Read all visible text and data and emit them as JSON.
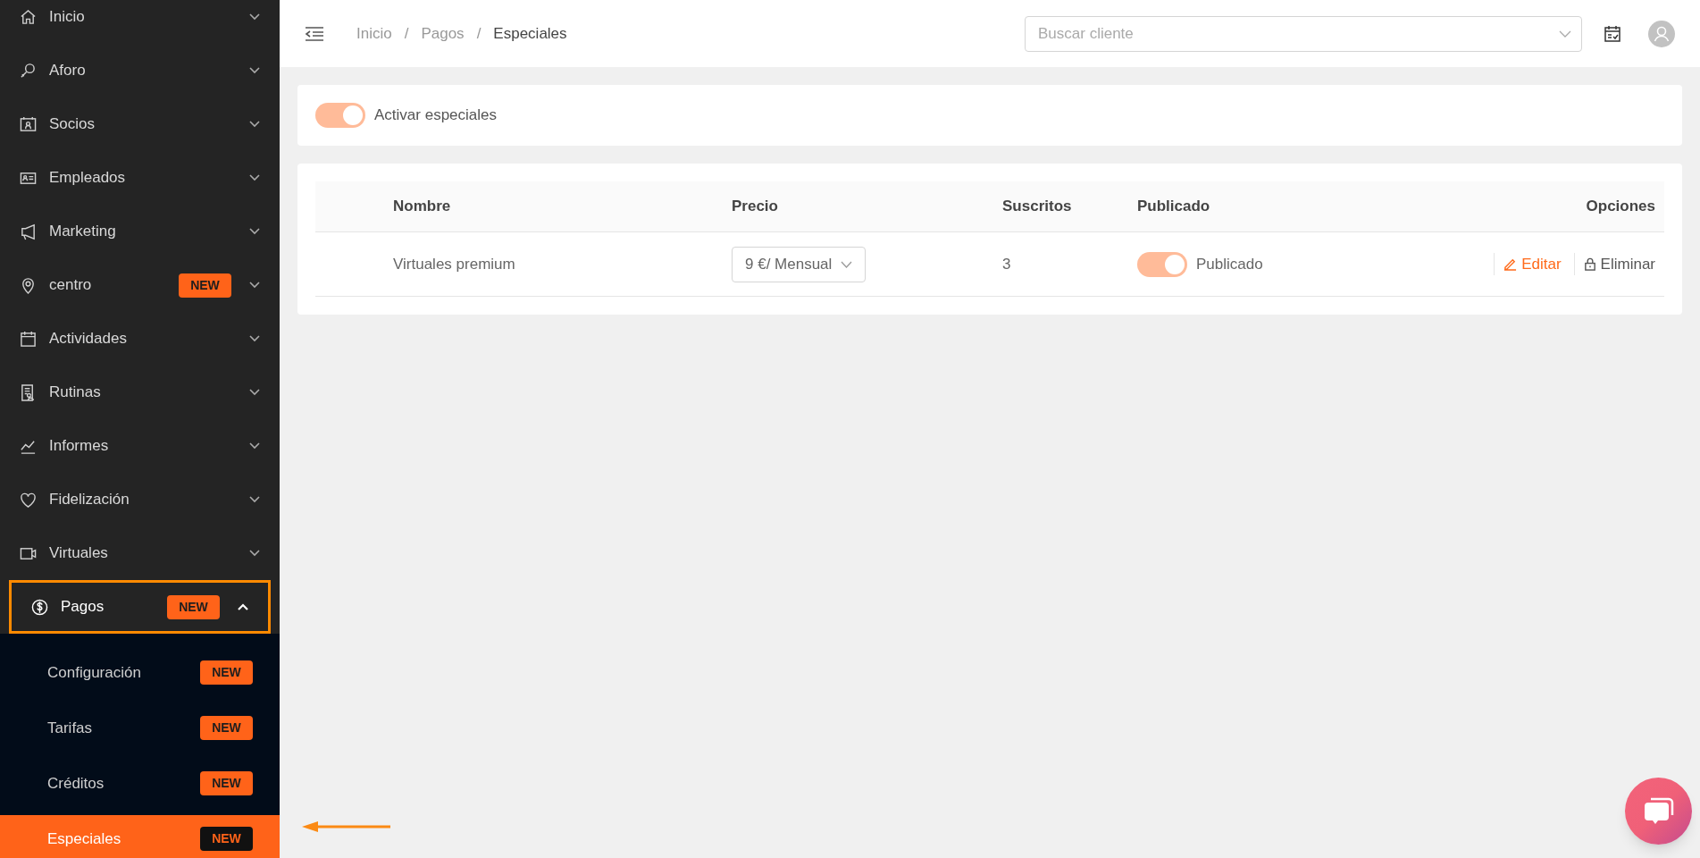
{
  "sidebar": {
    "items": [
      {
        "label": "Inicio",
        "expanded": false,
        "outlined": false
      },
      {
        "label": "Aforo",
        "expanded": false,
        "outlined": false
      },
      {
        "label": "Socios",
        "expanded": false,
        "outlined": false
      },
      {
        "label": "Empleados",
        "expanded": false,
        "outlined": false
      },
      {
        "label": "Marketing",
        "expanded": false,
        "outlined": false
      },
      {
        "label": "centro",
        "badge": "NEW",
        "expanded": false,
        "outlined": false
      },
      {
        "label": "Actividades",
        "expanded": false,
        "outlined": false
      },
      {
        "label": "Rutinas",
        "expanded": false,
        "outlined": false
      },
      {
        "label": "Informes",
        "expanded": false,
        "outlined": false
      },
      {
        "label": "Fidelización",
        "expanded": false,
        "outlined": false
      },
      {
        "label": "Virtuales",
        "expanded": false,
        "outlined": false
      },
      {
        "label": "Pagos",
        "badge": "NEW",
        "expanded": true,
        "outlined": true,
        "children": [
          {
            "label": "Configuración",
            "badge": "NEW",
            "selected": false
          },
          {
            "label": "Tarifas",
            "badge": "NEW",
            "selected": false
          },
          {
            "label": "Créditos",
            "badge": "NEW",
            "selected": false
          },
          {
            "label": "Especiales",
            "badge": "NEW",
            "selected": true
          }
        ]
      }
    ]
  },
  "header": {
    "breadcrumb": [
      "Inicio",
      "Pagos",
      "Especiales"
    ],
    "breadcrumb_separators": [
      "/",
      "/"
    ],
    "search": {
      "placeholder": "Buscar cliente"
    }
  },
  "activate": {
    "label": "Activar especiales",
    "on": true
  },
  "table": {
    "columns": [
      "Nombre",
      "Precio",
      "Suscritos",
      "Publicado",
      "Opciones"
    ],
    "rows": [
      {
        "nombre": "Virtuales premium",
        "precio": "9 €/ Mensual",
        "suscritos": "3",
        "published": true,
        "published_label": "Publicado",
        "edit": "Editar",
        "delete": "Eliminar"
      }
    ]
  }
}
